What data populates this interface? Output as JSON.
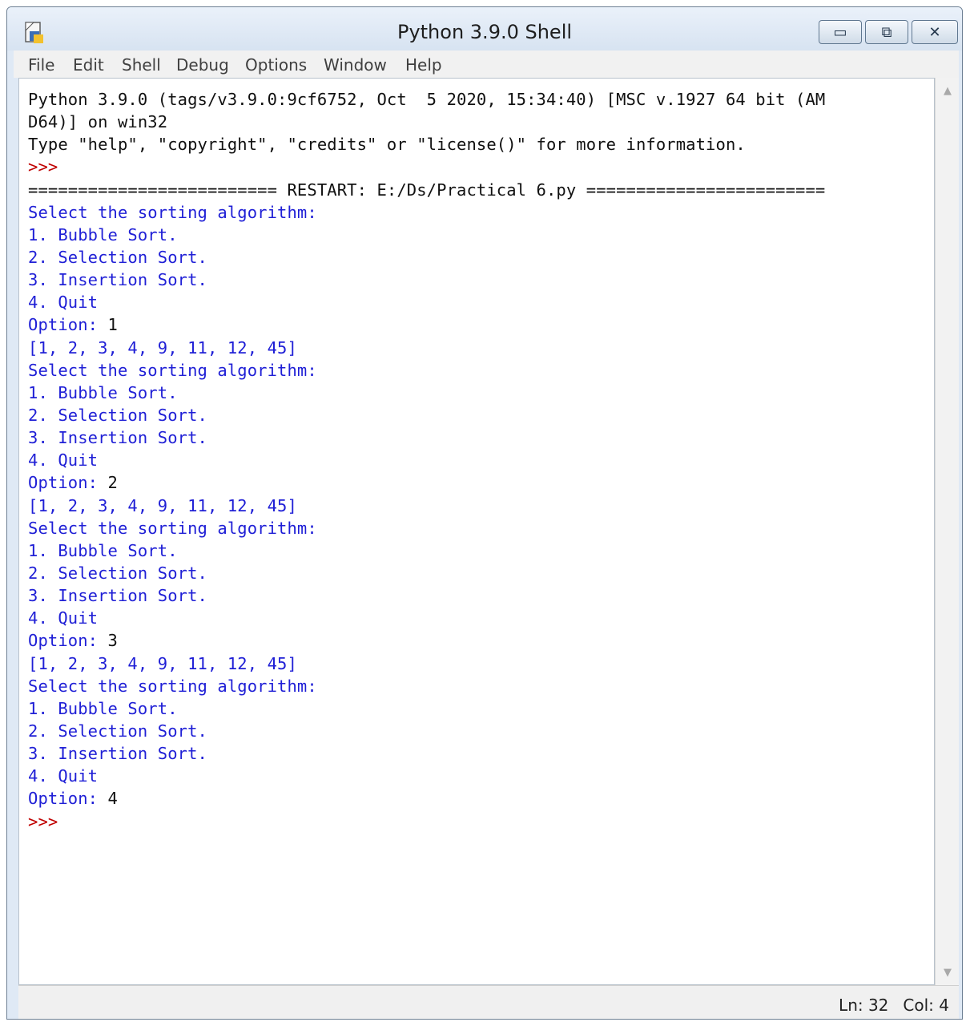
{
  "window": {
    "title": "Python 3.9.0 Shell"
  },
  "menu": [
    "File",
    "Edit",
    "Shell",
    "Debug",
    "Options",
    "Window",
    "Help"
  ],
  "buttons": {
    "minimize": "▭",
    "maximize": "⧉",
    "close": "✕"
  },
  "shell_lines": [
    {
      "text": "Python 3.9.0 (tags/v3.9.0:9cf6752, Oct  5 2020, 15:34:40) [MSC v.1927 64 bit (AM",
      "style": "out"
    },
    {
      "text": "D64)] on win32",
      "style": "out"
    },
    {
      "text": "Type \"help\", \"copyright\", \"credits\" or \"license()\" for more information.",
      "style": "out"
    },
    {
      "text": ">>> ",
      "style": "prompt"
    },
    {
      "text": "========================= RESTART: E:/Ds/Practical 6.py ========================",
      "style": "out"
    },
    {
      "text": "Select the sorting algorithm:",
      "style": "prog"
    },
    {
      "text": "1. Bubble Sort.",
      "style": "prog"
    },
    {
      "text": "2. Selection Sort.",
      "style": "prog"
    },
    {
      "text": "3. Insertion Sort.",
      "style": "prog"
    },
    {
      "text": "4. Quit",
      "style": "prog"
    },
    {
      "text": "Option: ",
      "style": "prog",
      "input": "1"
    },
    {
      "text": "[1, 2, 3, 4, 9, 11, 12, 45]",
      "style": "prog"
    },
    {
      "text": "Select the sorting algorithm:",
      "style": "prog"
    },
    {
      "text": "1. Bubble Sort.",
      "style": "prog"
    },
    {
      "text": "2. Selection Sort.",
      "style": "prog"
    },
    {
      "text": "3. Insertion Sort.",
      "style": "prog"
    },
    {
      "text": "4. Quit",
      "style": "prog"
    },
    {
      "text": "Option: ",
      "style": "prog",
      "input": "2"
    },
    {
      "text": "[1, 2, 3, 4, 9, 11, 12, 45]",
      "style": "prog"
    },
    {
      "text": "Select the sorting algorithm:",
      "style": "prog"
    },
    {
      "text": "1. Bubble Sort.",
      "style": "prog"
    },
    {
      "text": "2. Selection Sort.",
      "style": "prog"
    },
    {
      "text": "3. Insertion Sort.",
      "style": "prog"
    },
    {
      "text": "4. Quit",
      "style": "prog"
    },
    {
      "text": "Option: ",
      "style": "prog",
      "input": "3"
    },
    {
      "text": "[1, 2, 3, 4, 9, 11, 12, 45]",
      "style": "prog"
    },
    {
      "text": "Select the sorting algorithm:",
      "style": "prog"
    },
    {
      "text": "1. Bubble Sort.",
      "style": "prog"
    },
    {
      "text": "2. Selection Sort.",
      "style": "prog"
    },
    {
      "text": "3. Insertion Sort.",
      "style": "prog"
    },
    {
      "text": "4. Quit",
      "style": "prog"
    },
    {
      "text": "Option: ",
      "style": "prog",
      "input": "4"
    },
    {
      "text": ">>> ",
      "style": "prompt"
    }
  ],
  "status": {
    "ln": "Ln: 32",
    "col": "Col: 4"
  },
  "colors": {
    "output": "#111111",
    "program_output": "#1f1fd6",
    "prompt": "#c00000"
  },
  "icons": {
    "app": "python-idle-icon",
    "scroll_up": "chevron-up-icon",
    "scroll_down": "chevron-down-icon"
  }
}
